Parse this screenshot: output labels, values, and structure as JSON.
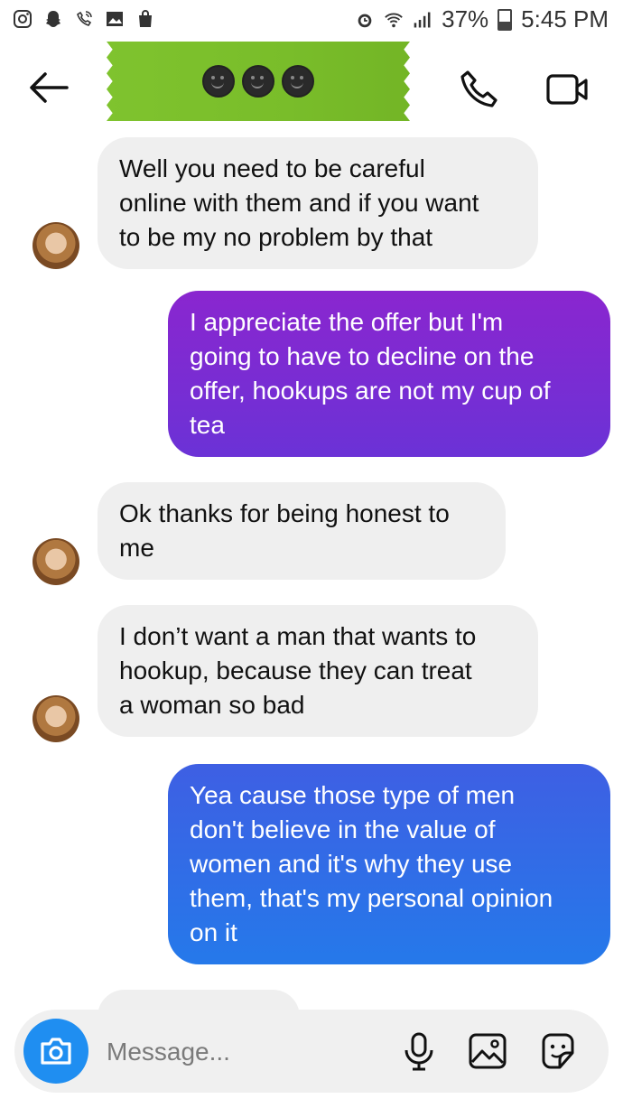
{
  "status": {
    "battery": "37%",
    "time": "5:45 PM"
  },
  "header": {
    "contact_emojis": [
      "smiley",
      "smiley",
      "smiley"
    ]
  },
  "messages": [
    {
      "side": "incoming",
      "text": "Well you need to be careful\nonline with them and if you want\nto be my no problem by that"
    },
    {
      "side": "outgoing",
      "text": "I appreciate the offer but I'm\ngoing to have to decline on the\noffer, hookups are not my cup of\ntea"
    },
    {
      "side": "incoming",
      "text": "Ok thanks for being honest to\nme"
    },
    {
      "side": "incoming",
      "text": "I don’t want a man that wants to\nhookup, because they can treat\na woman so bad"
    },
    {
      "side": "outgoing",
      "text": "Yea cause those type of men\ndon't believe in the value of\nwomen and it's why they use\nthem, that's my personal opinion\non it"
    }
  ],
  "composer": {
    "placeholder": "Message..."
  },
  "colors": {
    "outgoing_purple": "#7a2bd3",
    "outgoing_blue": "#2e6fe6",
    "incoming_bg": "#efefef",
    "camera_blue": "#1f8ef1"
  },
  "icons": [
    "instagram-icon",
    "snapchat-icon",
    "call-signal-icon",
    "gallery-icon",
    "shopping-bag-icon",
    "alarm-icon",
    "wifi-icon",
    "signal-icon",
    "battery-icon",
    "back-arrow-icon",
    "phone-icon",
    "video-camera-icon",
    "camera-icon",
    "microphone-icon",
    "image-icon",
    "sticker-icon"
  ]
}
